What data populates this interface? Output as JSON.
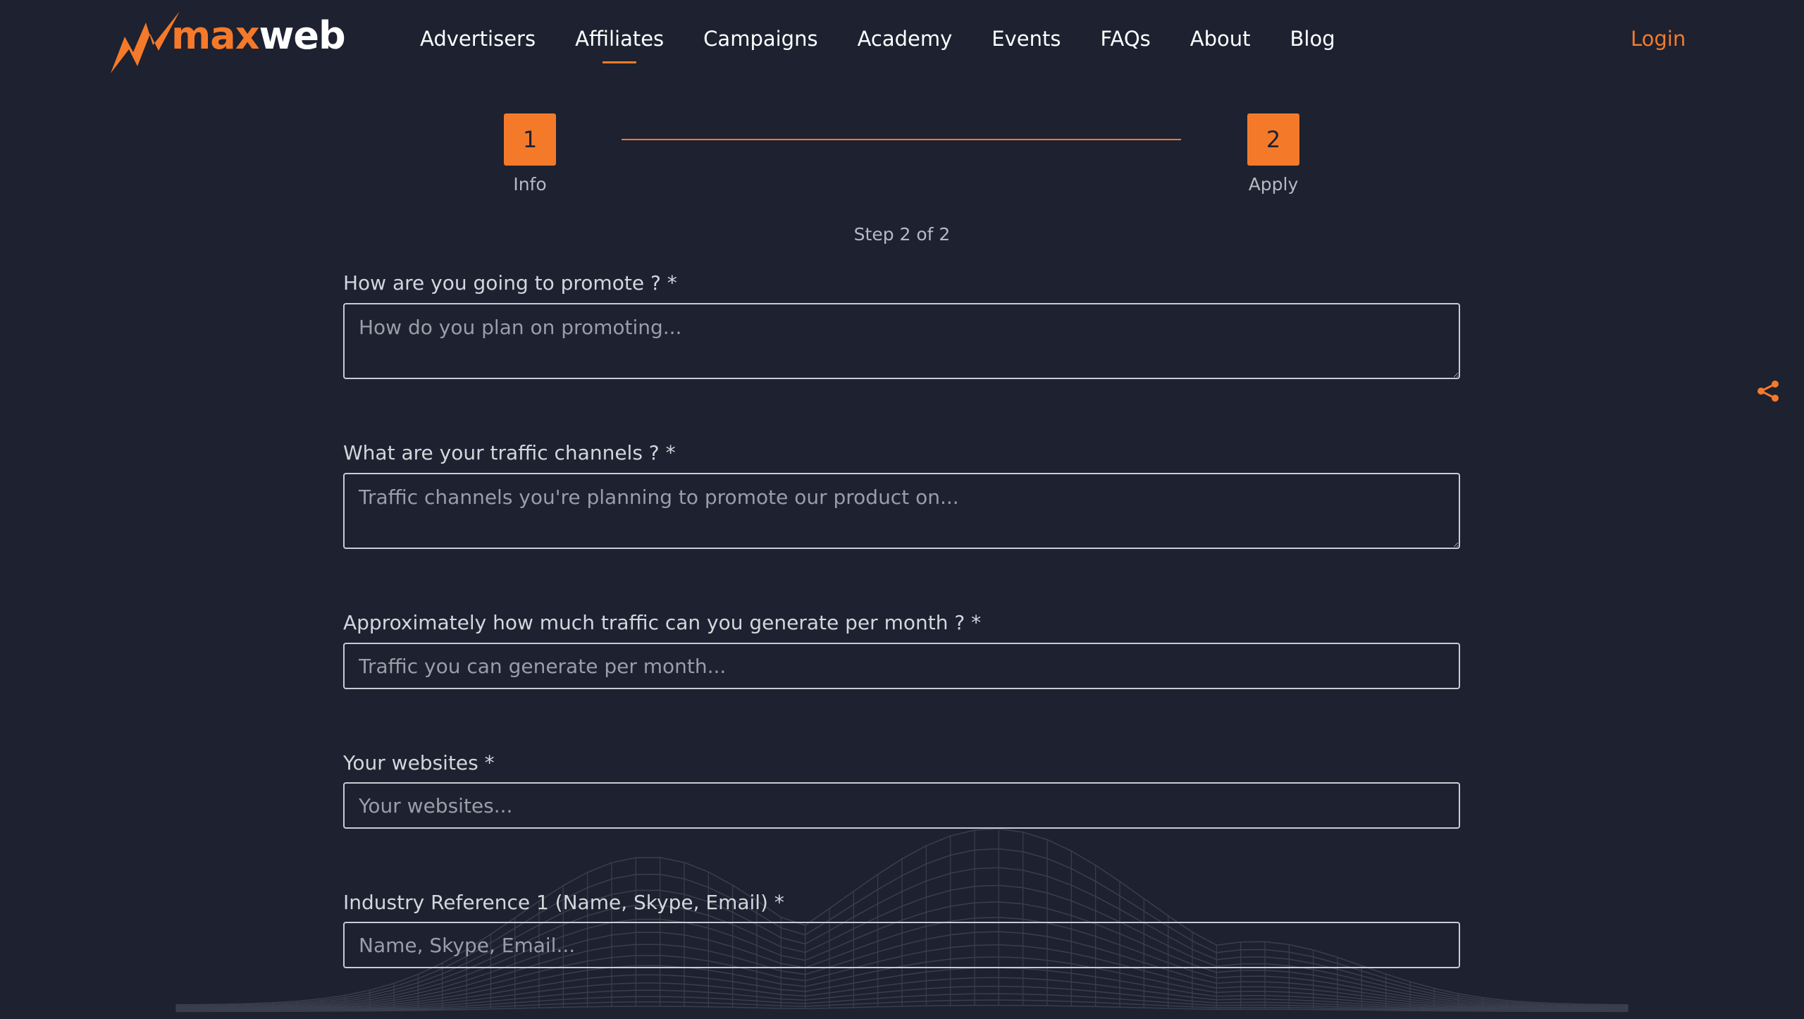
{
  "brand": {
    "name_part1": "max",
    "name_part2": "web",
    "accent_color": "#f47a2a",
    "background_color": "#1d2130"
  },
  "nav": {
    "items": [
      {
        "label": "Advertisers"
      },
      {
        "label": "Affiliates",
        "active": true
      },
      {
        "label": "Campaigns"
      },
      {
        "label": "Academy"
      },
      {
        "label": "Events"
      },
      {
        "label": "FAQs"
      },
      {
        "label": "About"
      },
      {
        "label": "Blog"
      }
    ],
    "login_label": "Login"
  },
  "stepper": {
    "steps": [
      {
        "number": "1",
        "label": "Info"
      },
      {
        "number": "2",
        "label": "Apply"
      }
    ],
    "progress_text": "Step 2 of 2"
  },
  "form": {
    "fields": [
      {
        "label": "How are you going to promote ? *",
        "placeholder": "How do you plan on promoting...",
        "value": ""
      },
      {
        "label": "What are your traffic channels ? *",
        "placeholder": "Traffic channels you're planning to promote our product on...",
        "value": ""
      },
      {
        "label": "Approximately how much traffic can you generate per month ? *",
        "placeholder": "Traffic you can generate per month...",
        "value": ""
      },
      {
        "label": "Your websites *",
        "placeholder": "Your websites...",
        "value": ""
      },
      {
        "label": "Industry Reference 1 (Name, Skype, Email) *",
        "placeholder": "Name, Skype, Email...",
        "value": ""
      }
    ]
  },
  "icons": {
    "logo": "lightning-bolt-icon",
    "share": "share-icon"
  }
}
